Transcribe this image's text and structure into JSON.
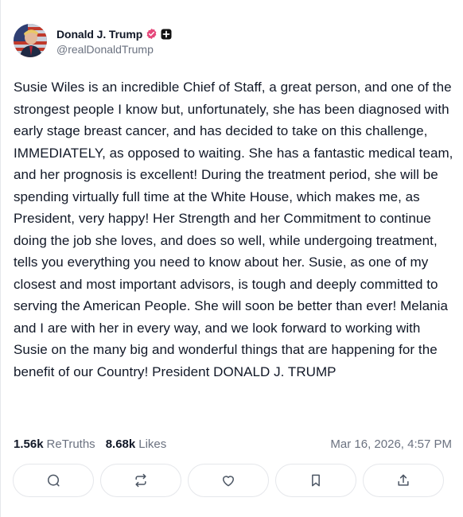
{
  "author": {
    "display_name": "Donald J. Trump",
    "handle": "@realDonaldTrump",
    "verified_icon": "verified-badge-icon",
    "badge_icon": "plus-badge-icon"
  },
  "post": {
    "text": "Susie Wiles is an incredible Chief of Staff, a great person, and one of the strongest people I know but, unfortunately, she has been diagnosed with early stage breast cancer, and has decided to take on this challenge, IMMEDIATELY, as opposed to waiting. She has a fantastic medical team, and her prognosis is excellent! During the treatment period, she will be spending virtually full time at the White House, which makes me, as President, very happy! Her Strength and her Commitment to continue doing the job she loves, and does so well, while undergoing treatment, tells you everything you need to know about her. Susie, as one of my closest and most important advisors, is tough and deeply committed to serving the American People. She will soon be better than ever! Melania and I are with her in every way, and we look forward to working with Susie on the many big and wonderful things that are happening for the benefit of our Country! President DONALD J. TRUMP"
  },
  "stats": {
    "retruths_count": "1.56k",
    "retruths_label": "ReTruths",
    "likes_count": "8.68k",
    "likes_label": "Likes",
    "timestamp": "Mar 16, 2026, 4:57 PM"
  },
  "actions": [
    {
      "name": "reply-button",
      "icon": "comment-icon"
    },
    {
      "name": "retruth-button",
      "icon": "repost-icon"
    },
    {
      "name": "like-button",
      "icon": "heart-icon"
    },
    {
      "name": "bookmark-button",
      "icon": "bookmark-icon"
    },
    {
      "name": "share-button",
      "icon": "share-icon"
    }
  ],
  "colors": {
    "verified": "#e5487b",
    "text": "#111827",
    "muted": "#6b7280",
    "border": "#e5e7eb"
  }
}
